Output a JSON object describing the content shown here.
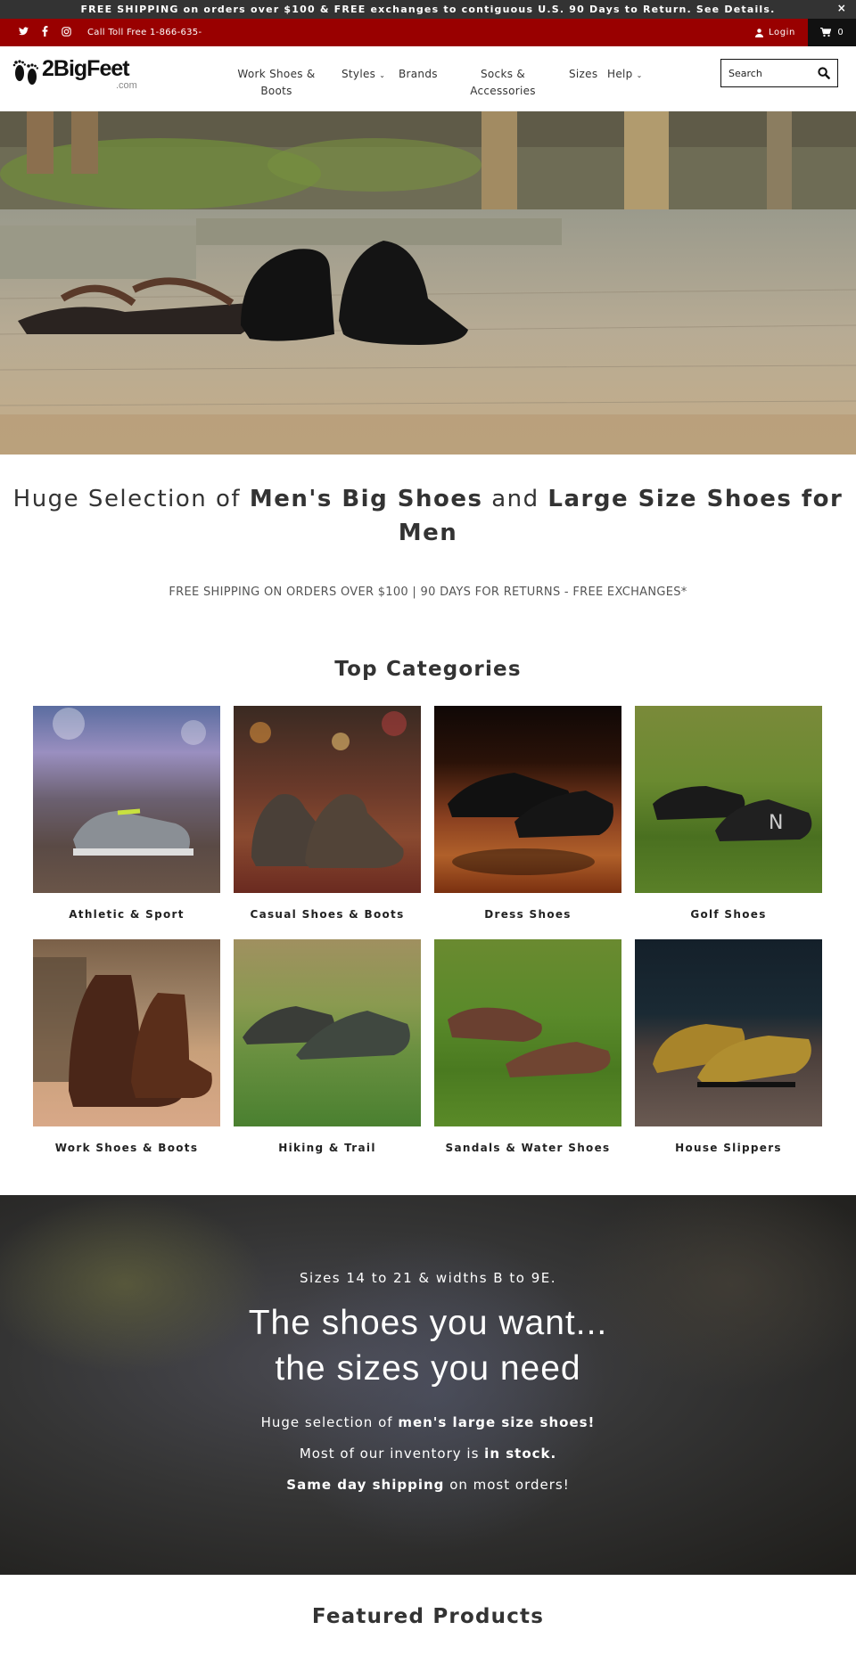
{
  "announcement": {
    "text": "FREE SHIPPING on orders over $100 & FREE exchanges to contiguous U.S. 90 Days to Return. See Details.",
    "close_icon": "×"
  },
  "utility_bar": {
    "phone": "Call Toll Free 1-866-635-",
    "login": "Login",
    "cart_count": "0",
    "social": [
      "twitter-icon",
      "facebook-icon",
      "instagram-icon"
    ],
    "color": "#990000"
  },
  "header": {
    "logo_text": "2BigFeet",
    "logo_suffix": ".com",
    "nav": [
      {
        "label_line1": "Work Shoes &",
        "label_line2": "Boots"
      },
      {
        "label": "Styles",
        "dropdown": true
      },
      {
        "label": "Brands"
      },
      {
        "label_line1": "Socks &",
        "label_line2": "Accessories"
      },
      {
        "label": "Sizes"
      },
      {
        "label": "Help",
        "dropdown": true
      }
    ],
    "search_placeholder": "Search"
  },
  "intro": {
    "title_part1": "Huge Selection of",
    "title_bold1": "Men's Big Shoes",
    "title_part2": "and",
    "title_bold2": "Large Size Shoes for Men",
    "subtitle": "FREE SHIPPING ON ORDERS OVER $100 | 90 DAYS FOR RETURNS - FREE EXCHANGES*"
  },
  "top_categories": {
    "title": "Top Categories",
    "items": [
      {
        "label": "Athletic & Sport"
      },
      {
        "label": "Casual Shoes & Boots"
      },
      {
        "label": "Dress Shoes"
      },
      {
        "label": "Golf Shoes"
      },
      {
        "label": "Work Shoes & Boots"
      },
      {
        "label": "Hiking & Trail"
      },
      {
        "label": "Sandals & Water Shoes"
      },
      {
        "label": "House Slippers"
      }
    ]
  },
  "promo": {
    "kicker": "Sizes 14 to 21 & widths B to 9E.",
    "headline_line1": "The shoes you want...",
    "headline_line2": "the sizes you need",
    "line1_prefix": "Huge selection of",
    "line1_bold": "men's large size shoes!",
    "line2_prefix": "Most of our inventory is",
    "line2_bold": "in stock.",
    "line3_bold": "Same day shipping",
    "line3_suffix": "on most orders!"
  },
  "featured": {
    "title": "Featured Products"
  }
}
